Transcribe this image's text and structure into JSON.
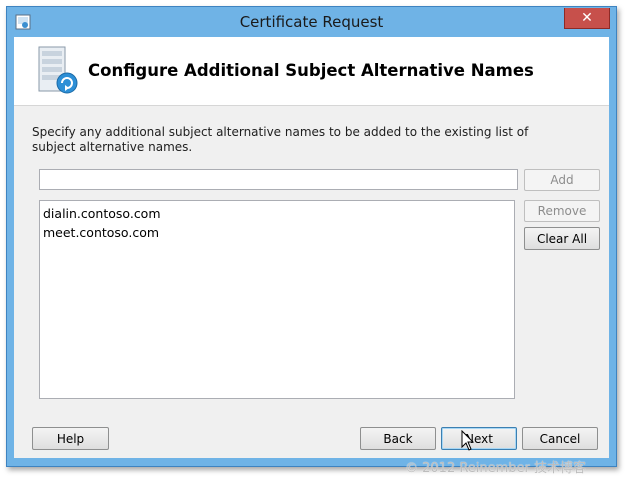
{
  "window": {
    "title": "Certificate Request",
    "close_label": "✕"
  },
  "header": {
    "title": "Configure Additional Subject Alternative Names",
    "icon": "certificate-server-icon"
  },
  "instructions": "Specify any additional subject alternative names to be added to the existing list of subject alternative names.",
  "name_input": {
    "value": "",
    "placeholder": ""
  },
  "buttons": {
    "add": "Add",
    "remove": "Remove",
    "clear_all": "Clear All",
    "help": "Help",
    "back": "Back",
    "next": "Next",
    "cancel": "Cancel"
  },
  "names_list": [
    "dialin.contoso.com",
    "meet.contoso.com"
  ],
  "watermark": "© 2012 Reinember 技术博客",
  "colors": {
    "titlebar": "#6fb3e6",
    "close": "#c7504b"
  }
}
